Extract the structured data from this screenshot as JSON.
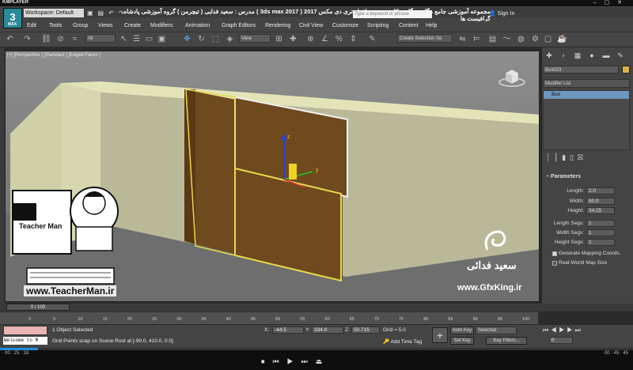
{
  "player": {
    "brand": "KMPLAYER",
    "right_label": "BOX",
    "time_elapsed": "00 : 25 : 18",
    "time_total": "00 : 45 : 45",
    "progress": 0.06
  },
  "header": {
    "max_logo_text": "3",
    "max_logo_sub": "MAX",
    "workspace": "Workspace: Default",
    "persian_title": "مجموعه آموزشی جامع ، گام به گام و کاربردی نرم افزار تری دی مکس 2017 ( 3ds max 2017 )   مدرس : سعید فدایی ( تیچرمن ) گروه آموزشی پادشاه گرافیست ها",
    "app_title": "Autodesk 3ds Max 2017     Untitled",
    "search_placeholder": "Type a keyword or phrase",
    "sign_in": "Sign In"
  },
  "menu": [
    "Edit",
    "Tools",
    "Group",
    "Views",
    "Create",
    "Modifiers",
    "Animation",
    "Graph Editors",
    "Rendering",
    "Civil View",
    "Customize",
    "Scripting",
    "Content",
    "Help"
  ],
  "toolbar": {
    "filter_drop": "All",
    "view_drop": "View",
    "selection_set": "Create Selection Se"
  },
  "viewport": {
    "label": "[+] [Perspective ] [Standard ] [Edged Faces ]"
  },
  "command_panel": {
    "object_name": "Box023",
    "object_color": "#d8b44a",
    "modifier_list": "Modifier List",
    "stack_item": "Box",
    "params_header": "Parameters",
    "params": [
      {
        "label": "Length:",
        "value": "2.0"
      },
      {
        "label": "Width:",
        "value": "80.0"
      },
      {
        "label": "Height:",
        "value": "34.25"
      },
      {
        "label": "Length Segs:",
        "value": "1"
      },
      {
        "label": "Width Segs:",
        "value": "1"
      },
      {
        "label": "Height Segs:",
        "value": "1"
      }
    ],
    "gen_mapping": "Generate Mapping Coords.",
    "real_world": "Real-World Map Size"
  },
  "timeline": {
    "slider": "0 / 100",
    "ticks": [
      "0",
      "5",
      "10",
      "15",
      "20",
      "25",
      "30",
      "35",
      "40",
      "45",
      "50",
      "55",
      "60",
      "65",
      "70",
      "75",
      "80",
      "85",
      "90",
      "95",
      "100"
    ]
  },
  "status": {
    "maxscript": "Welcome to M",
    "selection": "1 Object Selected",
    "prompt": "Grid Points snap on Scene Root at [-90.0, 410.0, 0.0]",
    "x_label": "X:",
    "x_value": "-44.5",
    "y_label": "Y:",
    "y_value": "334.0",
    "z_label": "Z:",
    "z_value": "50.715",
    "grid": "Grid = 5.0",
    "add_time_tag": "Add Time Tag",
    "auto_key": "Auto Key",
    "set_key": "Set Key",
    "selected_drop": "Selected",
    "key_filters": "Key Filters...",
    "frame": "0"
  },
  "watermark": {
    "left_site": "www.TeacherMan.ir",
    "right_name": "سعید فدائی",
    "right_site": "www.GfxKing.ir",
    "badge_name": "Teacher Man"
  }
}
